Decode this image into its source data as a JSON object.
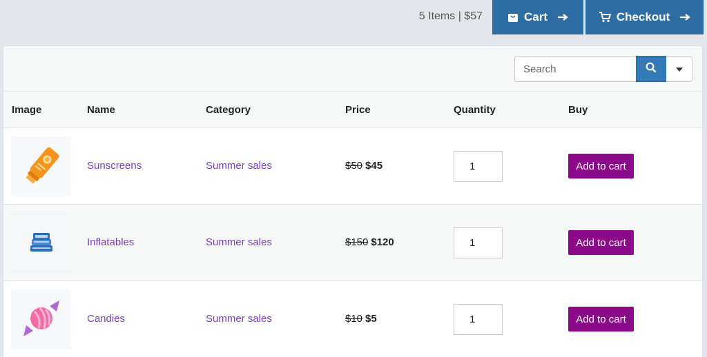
{
  "cart_summary": "5 Items | $57",
  "buttons": {
    "cart": "Cart",
    "checkout": "Checkout"
  },
  "search": {
    "placeholder": "Search"
  },
  "table": {
    "headers": [
      "Image",
      "Name",
      "Category",
      "Price",
      "Quantity",
      "Buy"
    ],
    "rows": [
      {
        "name": "Sunscreens",
        "category": "Summer sales",
        "old_price": "$50",
        "price": "$45",
        "quantity": "1",
        "action": "Add to cart",
        "icon": "sunscreen-icon"
      },
      {
        "name": "Inflatables",
        "category": "Summer sales",
        "old_price": "$150",
        "price": "$120",
        "quantity": "1",
        "action": "Add to cart",
        "icon": "inflatable-icon"
      },
      {
        "name": "Candies",
        "category": "Summer sales",
        "old_price": "$10",
        "price": "$5",
        "quantity": "1",
        "action": "Add to cart",
        "icon": "candy-icon"
      }
    ]
  },
  "colors": {
    "primary": "#337ab7",
    "accent": "#8a0a8a",
    "link": "#7a3fb8"
  }
}
